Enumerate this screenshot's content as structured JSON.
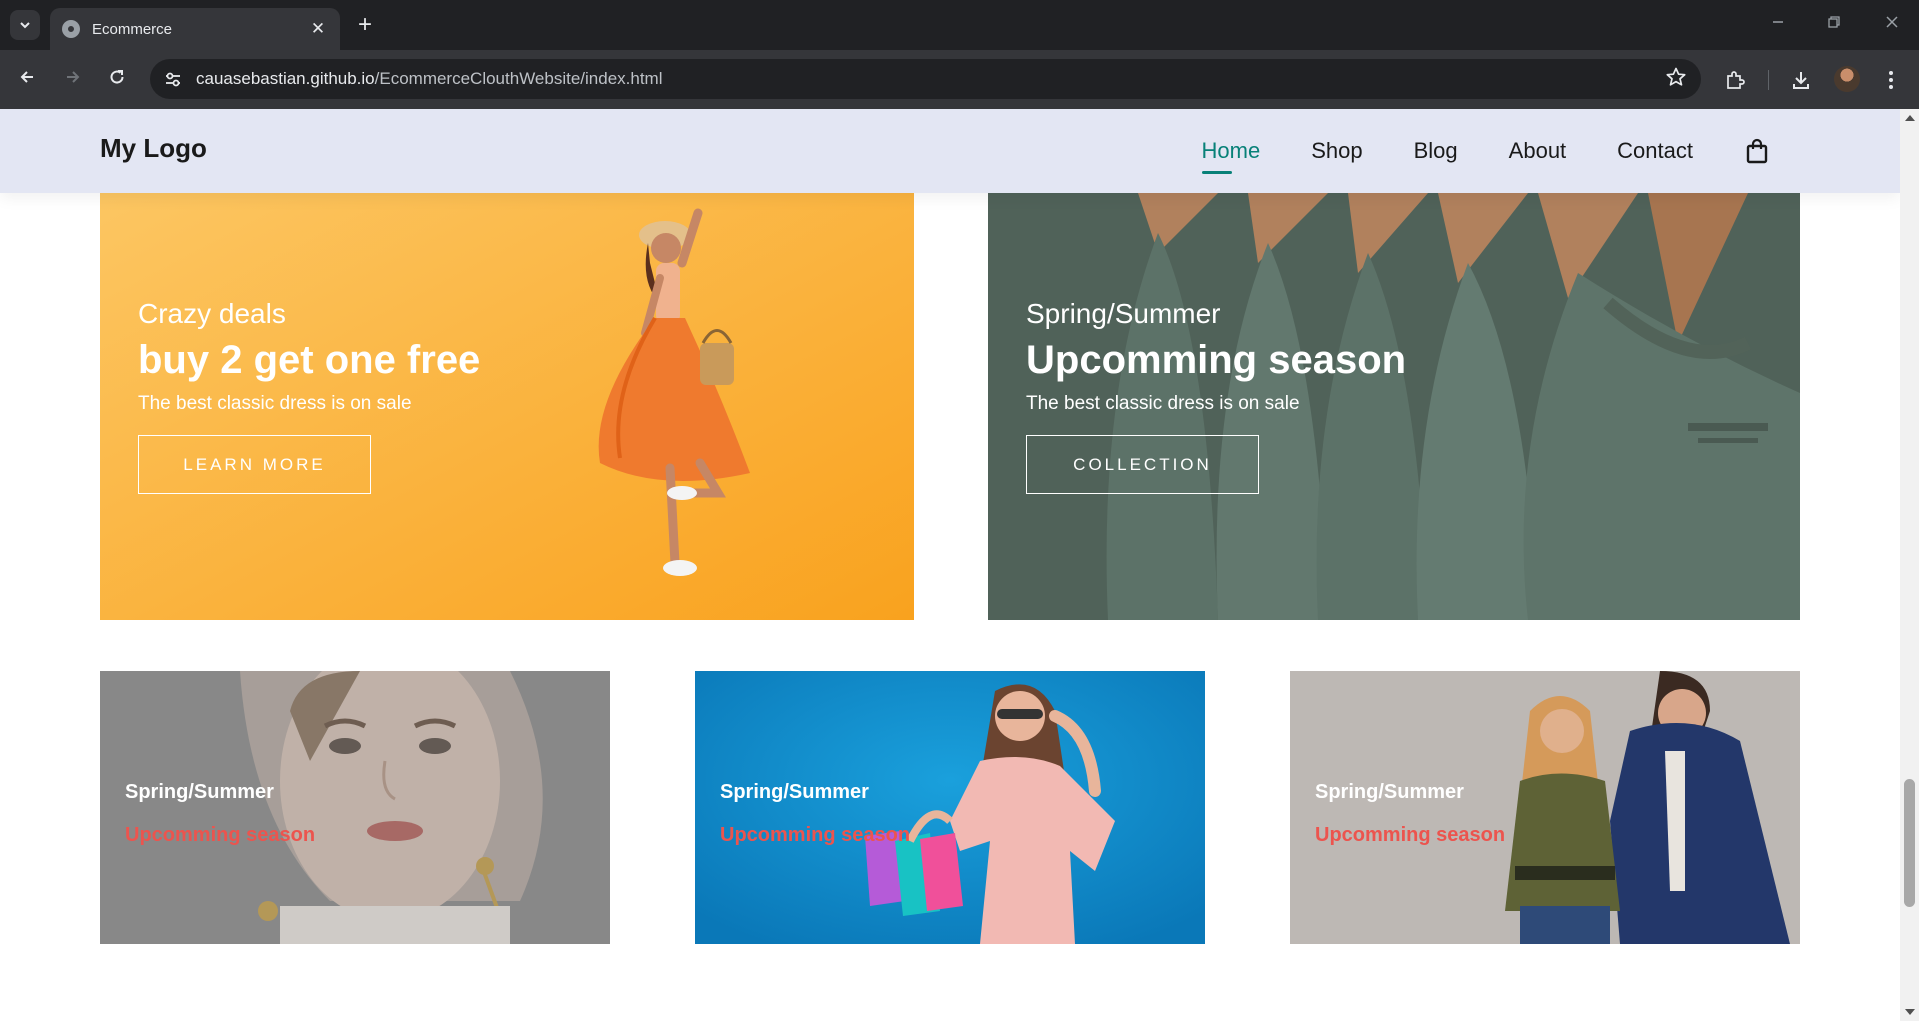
{
  "browser": {
    "tab_title": "Ecommerce",
    "new_tab": "+",
    "close": "✕",
    "url_host": "cauasebastian.github.io",
    "url_path": "/EcommerceClouthWebsite/index.html"
  },
  "site": {
    "logo": "My Logo",
    "nav": [
      "Home",
      "Shop",
      "Blog",
      "About",
      "Contact"
    ],
    "accent_color": "#088178",
    "header_bg": "#e3e6f3"
  },
  "banners": [
    {
      "small": "Crazy deals",
      "big": "buy 2 get one free",
      "desc": "The best classic dress is on sale",
      "button": "LEARN MORE",
      "bg": "#fbb33f"
    },
    {
      "small": "Spring/Summer",
      "big": "Upcomming season",
      "desc": "The best classic dress is on sale",
      "button": "COLLECTION",
      "bg": "#5d6f68"
    }
  ],
  "small_banners": [
    {
      "title": "Spring/Summer",
      "subtitle": "Upcomming season",
      "bg": "#8f8f8f"
    },
    {
      "title": "Spring/Summer",
      "subtitle": "Upcomming season",
      "bg": "#0e8cc8"
    },
    {
      "title": "Spring/Summer",
      "subtitle": "Upcomming season",
      "bg": "#bfbab6"
    }
  ],
  "icons": {
    "tab_search": "chevron-down-icon",
    "favicon": "globe-icon",
    "back": "arrow-left-icon",
    "forward": "arrow-right-icon",
    "reload": "reload-icon",
    "site_info": "tune-icon",
    "bookmark": "star-icon",
    "extensions": "puzzle-icon",
    "downloads": "download-icon",
    "menu": "kebab-menu-icon",
    "cart": "shopping-bag-icon"
  }
}
